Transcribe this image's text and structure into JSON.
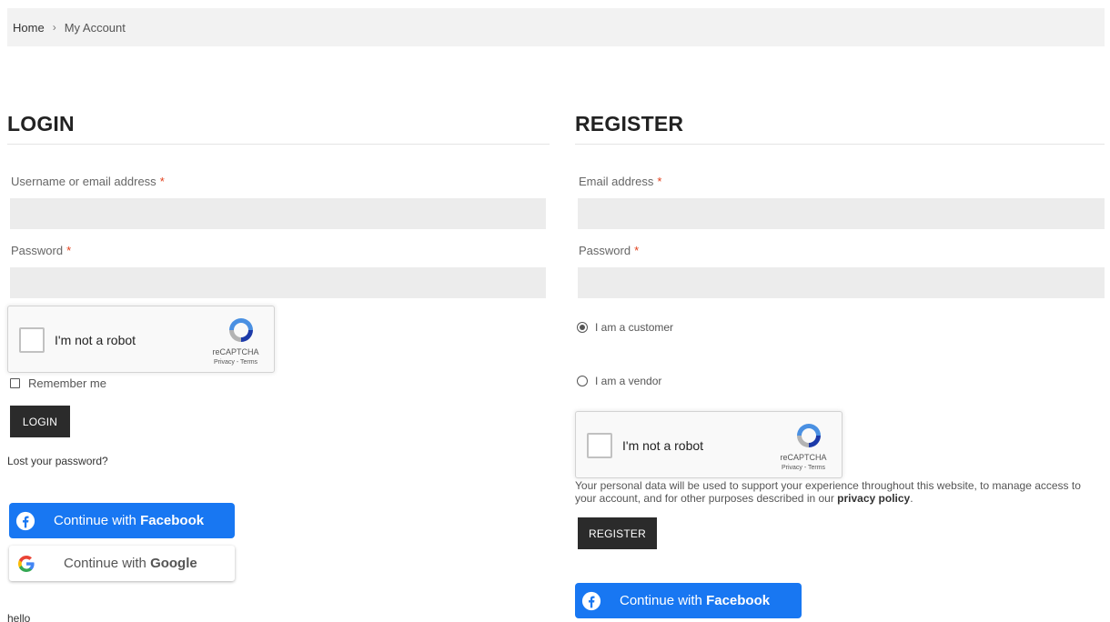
{
  "breadcrumb": {
    "home": "Home",
    "separator": "›",
    "current": "My Account"
  },
  "login": {
    "title": "LOGIN",
    "username_label": "Username or email address",
    "password_label": "Password",
    "required_mark": "*",
    "username_value": "",
    "password_value": "",
    "recaptcha": {
      "text": "I'm not a robot",
      "brand": "reCAPTCHA",
      "links": "Privacy - Terms"
    },
    "remember_label": "Remember me",
    "submit_label": "LOGIN",
    "lost_password": "Lost your password?",
    "facebook": {
      "prefix": "Continue with ",
      "bold": "Facebook"
    },
    "google": {
      "prefix": "Continue with ",
      "bold": "Google"
    },
    "footer_text": "hello"
  },
  "register": {
    "title": "REGISTER",
    "email_label": "Email address",
    "password_label": "Password",
    "required_mark": "*",
    "email_value": "",
    "password_value": "",
    "roles": [
      {
        "label": "I am a customer",
        "selected": true
      },
      {
        "label": "I am a vendor",
        "selected": false
      }
    ],
    "recaptcha": {
      "text": "I'm not a robot",
      "brand": "reCAPTCHA",
      "links": "Privacy - Terms"
    },
    "privacy_line1": "Your personal data will be used to support your experience throughout this website, to manage access to",
    "privacy_line2_prefix": "your account, and for other purposes described in our ",
    "privacy_link": "privacy policy",
    "privacy_line2_suffix": ".",
    "submit_label": "REGISTER",
    "facebook": {
      "prefix": "Continue with ",
      "bold": "Facebook"
    }
  },
  "colors": {
    "facebook": "#1877f2",
    "dark_button": "#2b2b2b",
    "input_bg": "#ececec",
    "required": "#e2401c"
  },
  "icons": [
    "chevron-right-icon",
    "recaptcha-icon",
    "facebook-icon",
    "google-icon"
  ]
}
